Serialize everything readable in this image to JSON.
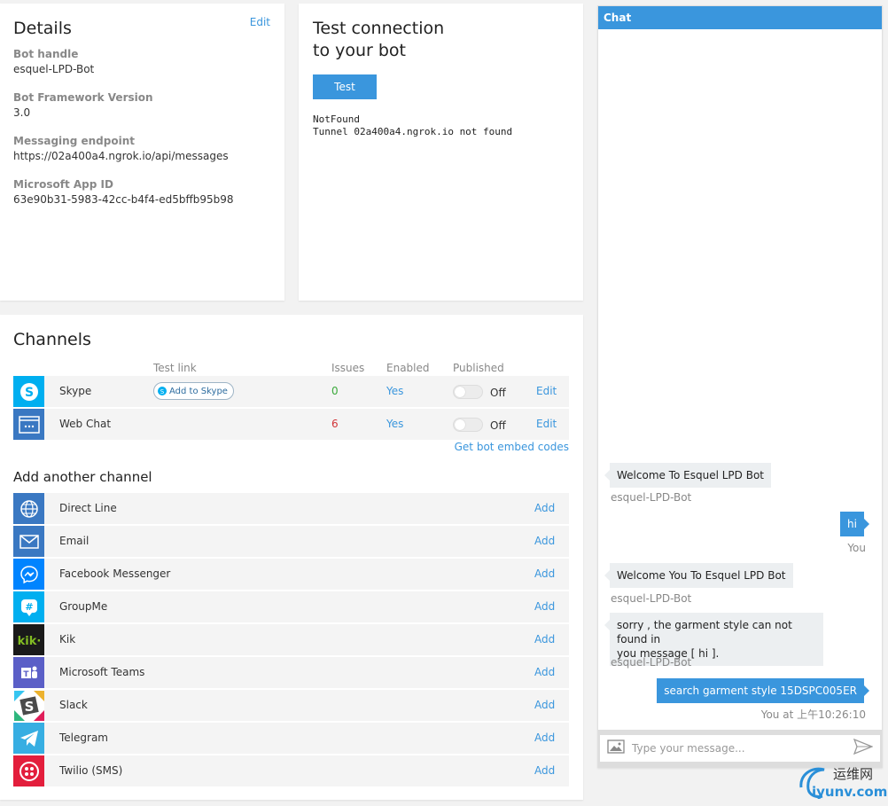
{
  "details": {
    "title": "Details",
    "edit": "Edit",
    "fields": [
      {
        "label": "Bot handle",
        "value": "esquel-LPD-Bot"
      },
      {
        "label": "Bot Framework Version",
        "value": "3.0"
      },
      {
        "label": "Messaging endpoint",
        "value": "https://02a400a4.ngrok.io/api/messages"
      },
      {
        "label": "Microsoft App ID",
        "value": "63e90b31-5983-42cc-b4f4-ed5bffb95b98"
      }
    ]
  },
  "test": {
    "title_line1": "Test connection",
    "title_line2": "to your bot",
    "button": "Test",
    "output_line1": "NotFound",
    "output_line2": "Tunnel 02a400a4.ngrok.io not found"
  },
  "channels": {
    "title": "Channels",
    "headers": {
      "test_link": "Test link",
      "issues": "Issues",
      "enabled": "Enabled",
      "published": "Published"
    },
    "rows": [
      {
        "name": "Skype",
        "test_link": "Add to Skype",
        "issues": "0",
        "enabled": "Yes",
        "published": "Off",
        "edit": "Edit"
      },
      {
        "name": "Web Chat",
        "test_link": "",
        "issues": "6",
        "enabled": "Yes",
        "published": "Off",
        "edit": "Edit"
      }
    ],
    "embed_link": "Get bot embed codes",
    "add_title": "Add another channel",
    "add_items": [
      {
        "name": "Direct Line",
        "action": "Add",
        "icon": "globe-icon",
        "color": "#3a78c2"
      },
      {
        "name": "Email",
        "action": "Add",
        "icon": "envelope-icon",
        "color": "#3a78c2"
      },
      {
        "name": "Facebook Messenger",
        "action": "Add",
        "icon": "messenger-icon",
        "color": "#0084ff"
      },
      {
        "name": "GroupMe",
        "action": "Add",
        "icon": "groupme-icon",
        "color": "#00aff0"
      },
      {
        "name": "Kik",
        "action": "Add",
        "icon": "kik-icon",
        "color": "#1a1a1a"
      },
      {
        "name": "Microsoft Teams",
        "action": "Add",
        "icon": "teams-icon",
        "color": "#5b5fc7"
      },
      {
        "name": "Slack",
        "action": "Add",
        "icon": "slack-icon",
        "color": "#ffffff"
      },
      {
        "name": "Telegram",
        "action": "Add",
        "icon": "telegram-icon",
        "color": "#37aee2"
      },
      {
        "name": "Twilio (SMS)",
        "action": "Add",
        "icon": "twilio-icon",
        "color": "#e31e3c"
      }
    ]
  },
  "chat": {
    "header": "Chat",
    "messages": [
      {
        "from": "bot",
        "text": "Welcome To Esquel LPD Bot",
        "meta": "esquel-LPD-Bot"
      },
      {
        "from": "user",
        "text": "hi",
        "meta": "You"
      },
      {
        "from": "bot",
        "text": "Welcome You To Esquel LPD Bot",
        "meta": "esquel-LPD-Bot"
      },
      {
        "from": "bot",
        "text_line1": "sorry , the garment style can not found in",
        "text_line2": "you message [ hi ].",
        "meta": "esquel-LPD-Bot"
      },
      {
        "from": "user",
        "text": "search garment style 15DSPC005ER",
        "meta": "You at 上午10:26:10"
      }
    ],
    "input_placeholder": "Type your message..."
  },
  "watermark": {
    "top": "运维网",
    "bottom": "iyunv.com"
  },
  "colors": {
    "accent": "#3a96dd",
    "issues_ok": "#3aa93a",
    "issues_bad": "#d13438"
  }
}
